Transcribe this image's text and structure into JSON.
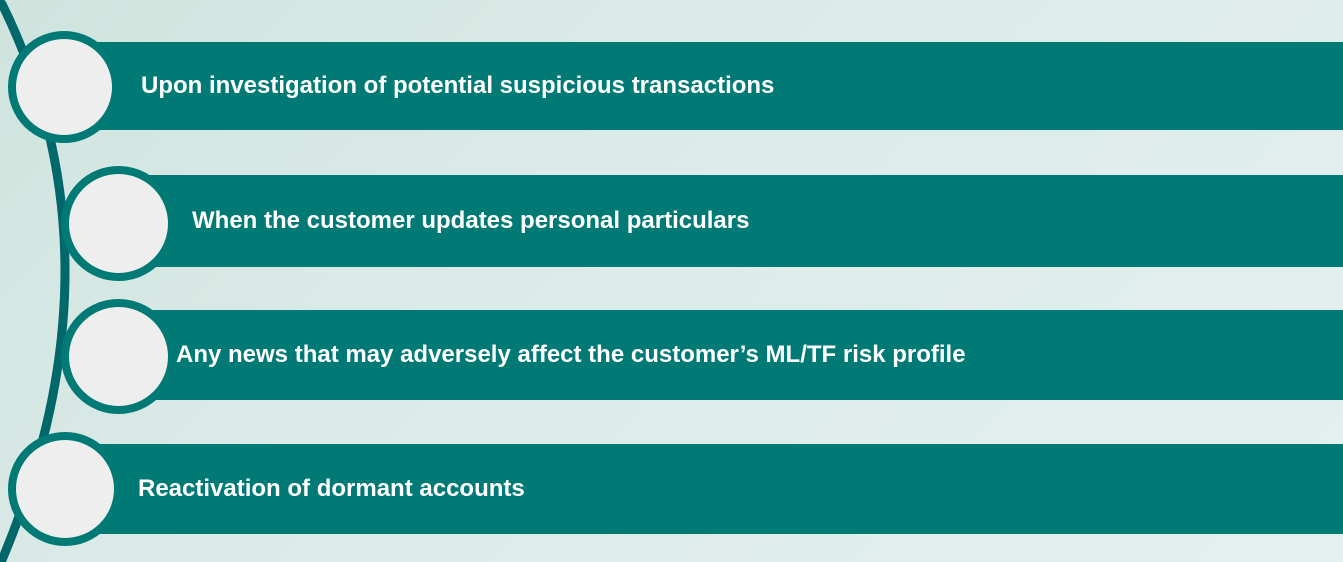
{
  "colors": {
    "bar": "#017a76",
    "bullet_fill": "#eeeeee",
    "bullet_ring": "#017a76",
    "arc": "#00676a",
    "text": "#ffffff"
  },
  "items": [
    {
      "label": "Upon investigation of potential suspicious transactions"
    },
    {
      "label": "When the customer updates personal particulars"
    },
    {
      "label": "Any news that may adversely affect the customer’s ML/TF risk profile"
    },
    {
      "label": "Reactivation of dormant accounts"
    }
  ]
}
